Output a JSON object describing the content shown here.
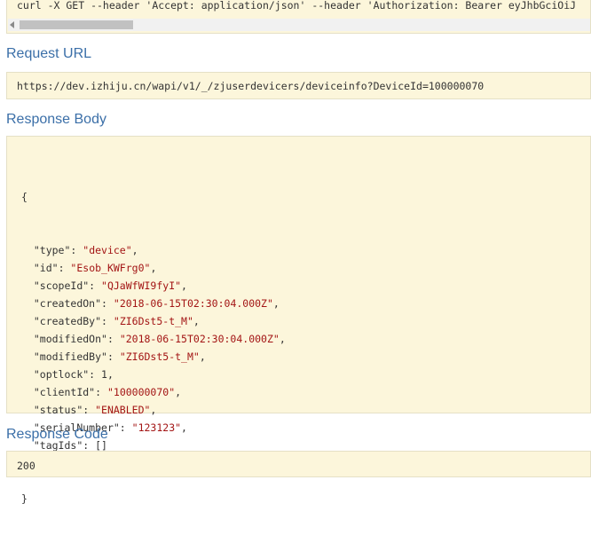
{
  "curl": {
    "command": "curl -X GET --header 'Accept: application/json' --header 'Authorization: Bearer eyJhbGciOiJ"
  },
  "request_url": {
    "heading": "Request URL",
    "value": "https://dev.izhiju.cn/wapi/v1/_/zjuserdevicers/deviceinfo?DeviceId=100000070"
  },
  "response_body": {
    "heading": "Response Body",
    "open_brace": "{",
    "close_brace": "}",
    "fields": [
      {
        "key": "\"type\"",
        "value": "\"device\"",
        "kind": "str"
      },
      {
        "key": "\"id\"",
        "value": "\"Esob_KWFrg0\"",
        "kind": "str"
      },
      {
        "key": "\"scopeId\"",
        "value": "\"QJaWfWI9fyI\"",
        "kind": "str"
      },
      {
        "key": "\"createdOn\"",
        "value": "\"2018-06-15T02:30:04.000Z\"",
        "kind": "str"
      },
      {
        "key": "\"createdBy\"",
        "value": "\"ZI6Dst5-t_M\"",
        "kind": "str"
      },
      {
        "key": "\"modifiedOn\"",
        "value": "\"2018-06-15T02:30:04.000Z\"",
        "kind": "str"
      },
      {
        "key": "\"modifiedBy\"",
        "value": "\"ZI6Dst5-t_M\"",
        "kind": "str"
      },
      {
        "key": "\"optlock\"",
        "value": "1",
        "kind": "num"
      },
      {
        "key": "\"clientId\"",
        "value": "\"100000070\"",
        "kind": "str"
      },
      {
        "key": "\"status\"",
        "value": "\"ENABLED\"",
        "kind": "str"
      },
      {
        "key": "\"serialNumber\"",
        "value": "\"123123\"",
        "kind": "str"
      },
      {
        "key": "\"tagIds\"",
        "value": "[]",
        "kind": "num"
      }
    ]
  },
  "response_code": {
    "heading": "Response Code",
    "value": "200"
  },
  "colors": {
    "heading": "#3b6fa8",
    "block_background": "#fcf6db",
    "string_value": "#a31515"
  }
}
